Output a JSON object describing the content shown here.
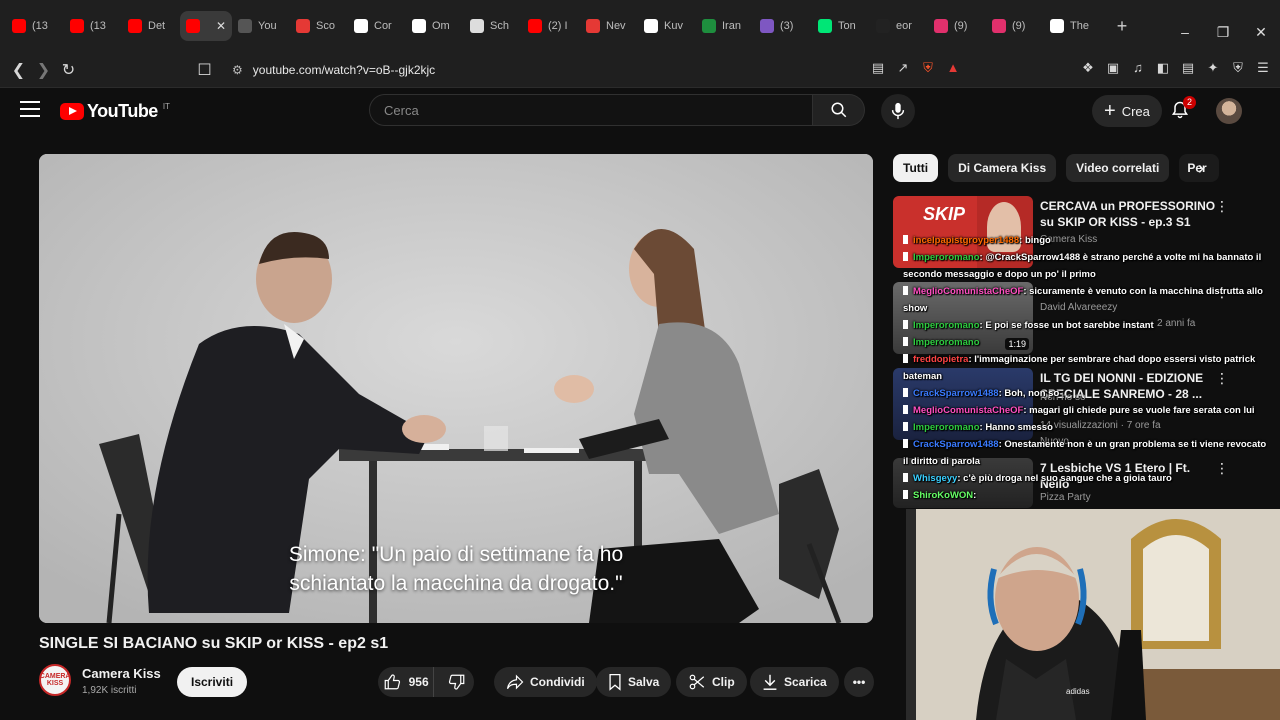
{
  "browser": {
    "tabs": [
      {
        "label": "(13",
        "color": "#ff0000"
      },
      {
        "label": "(13",
        "color": "#ff0000"
      },
      {
        "label": "Det",
        "color": "#ff0000"
      },
      {
        "label": "",
        "color": "#ff0000",
        "active": true
      },
      {
        "label": "You",
        "color": "#555555"
      },
      {
        "label": "Sco",
        "color": "#e53935"
      },
      {
        "label": "Cor",
        "color": "#ffffff"
      },
      {
        "label": "Om",
        "color": "#ffffff"
      },
      {
        "label": "Sch",
        "color": "#dddddd"
      },
      {
        "label": "(2) I",
        "color": "#ff0000"
      },
      {
        "label": "Nev",
        "color": "#e53935"
      },
      {
        "label": "Kuv",
        "color": "#ffffff"
      },
      {
        "label": "Iran",
        "color": "#1e8e3e"
      },
      {
        "label": "(3)",
        "color": "#7e57c2"
      },
      {
        "label": "Ton",
        "color": "#00e676"
      },
      {
        "label": "eor",
        "color": "#222222"
      },
      {
        "label": "(9)",
        "color": "#e1306c"
      },
      {
        "label": "(9)",
        "color": "#e1306c"
      },
      {
        "label": "The",
        "color": "#ffffff"
      }
    ],
    "url": "youtube.com/watch?v=oB--gjk2kjc"
  },
  "header": {
    "logo": "YouTube",
    "country": "IT",
    "search_placeholder": "Cerca",
    "create_label": "Crea",
    "notifications": "2"
  },
  "video": {
    "subtitle_line1": "Simone: \"Un paio di settimane fa ho",
    "subtitle_line2": "schiantato la macchina da drogato.\"",
    "title": "SINGLE SI BACIANO su SKIP or KISS - ep2 s1",
    "channel": "Camera Kiss",
    "channel_logo": "CAMERA KISS",
    "subscribers": "1,92K iscritti",
    "subscribe_label": "Iscriviti",
    "likes": "956",
    "share_label": "Condividi",
    "save_label": "Salva",
    "clip_label": "Clip",
    "download_label": "Scarica"
  },
  "chips": [
    "Tutti",
    "Di Camera Kiss",
    "Video correlati",
    "Per"
  ],
  "recommendations": [
    {
      "title": "CERCAVA un PROFESSORINO su SKIP OR KISS - ep.3 S1",
      "channel": "Camera Kiss",
      "thumb_text": "SKIP"
    },
    {
      "title": "",
      "channel": "David Alvareeezy",
      "meta": "2 anni fa",
      "duration": "1:19"
    },
    {
      "title": "IL TG DEI NONNI - EDIZIONE SPECIALE SANREMO - 28 ...",
      "channel": "Non ho so",
      "meta": "14 visualizzazioni · 7 ore fa",
      "badge": "Nuovo"
    },
    {
      "title": "7 Lesbiche VS 1 Etero | Ft. Nello",
      "channel": "Pizza Party"
    }
  ],
  "chat": [
    {
      "user": "incelpapistgroyper1488",
      "user_color": "#ff6a00",
      "text": ": bingo"
    },
    {
      "user": "Imperoromano",
      "user_color": "#2ecc40",
      "text": ": @CrackSparrow1488 è strano perché a volte mi ha bannato il secondo messaggio e dopo un po' il primo"
    },
    {
      "user": "MeglioComunistaCheOF",
      "user_color": "#ff4fc1",
      "text": ": sicuramente è venuto con la macchina distrutta allo show"
    },
    {
      "user": "Imperoromano",
      "user_color": "#2ecc40",
      "text": ": E poi se fosse un bot sarebbe instant"
    },
    {
      "user": "Imperoromano",
      "user_color": "#2ecc40",
      "text": ""
    },
    {
      "user": "freddopietra",
      "user_color": "#ff4444",
      "text": ": l'immaginazione per sembrare chad dopo essersi visto patrick bateman"
    },
    {
      "user": "CrackSparrow1488",
      "user_color": "#3a7bff",
      "text": ": Boh, non so"
    },
    {
      "user": "MeglioComunistaCheOF",
      "user_color": "#ff4fc1",
      "text": ": magari gli chiede pure se vuole fare serata con lui"
    },
    {
      "user": "Imperoromano",
      "user_color": "#2ecc40",
      "text": ": Hanno smesso"
    },
    {
      "user": "CrackSparrow1488",
      "user_color": "#3a7bff",
      "text": ": Onestamente non è un gran problema se ti viene revocato il diritto di parola"
    },
    {
      "user": "Whisgeyy",
      "user_color": "#3ad0ff",
      "text": ": c'è più droga nel suo sangue che a gioia tauro"
    },
    {
      "user": "ShiroKoWON",
      "user_color": "#66ff66",
      "text": ":"
    }
  ]
}
